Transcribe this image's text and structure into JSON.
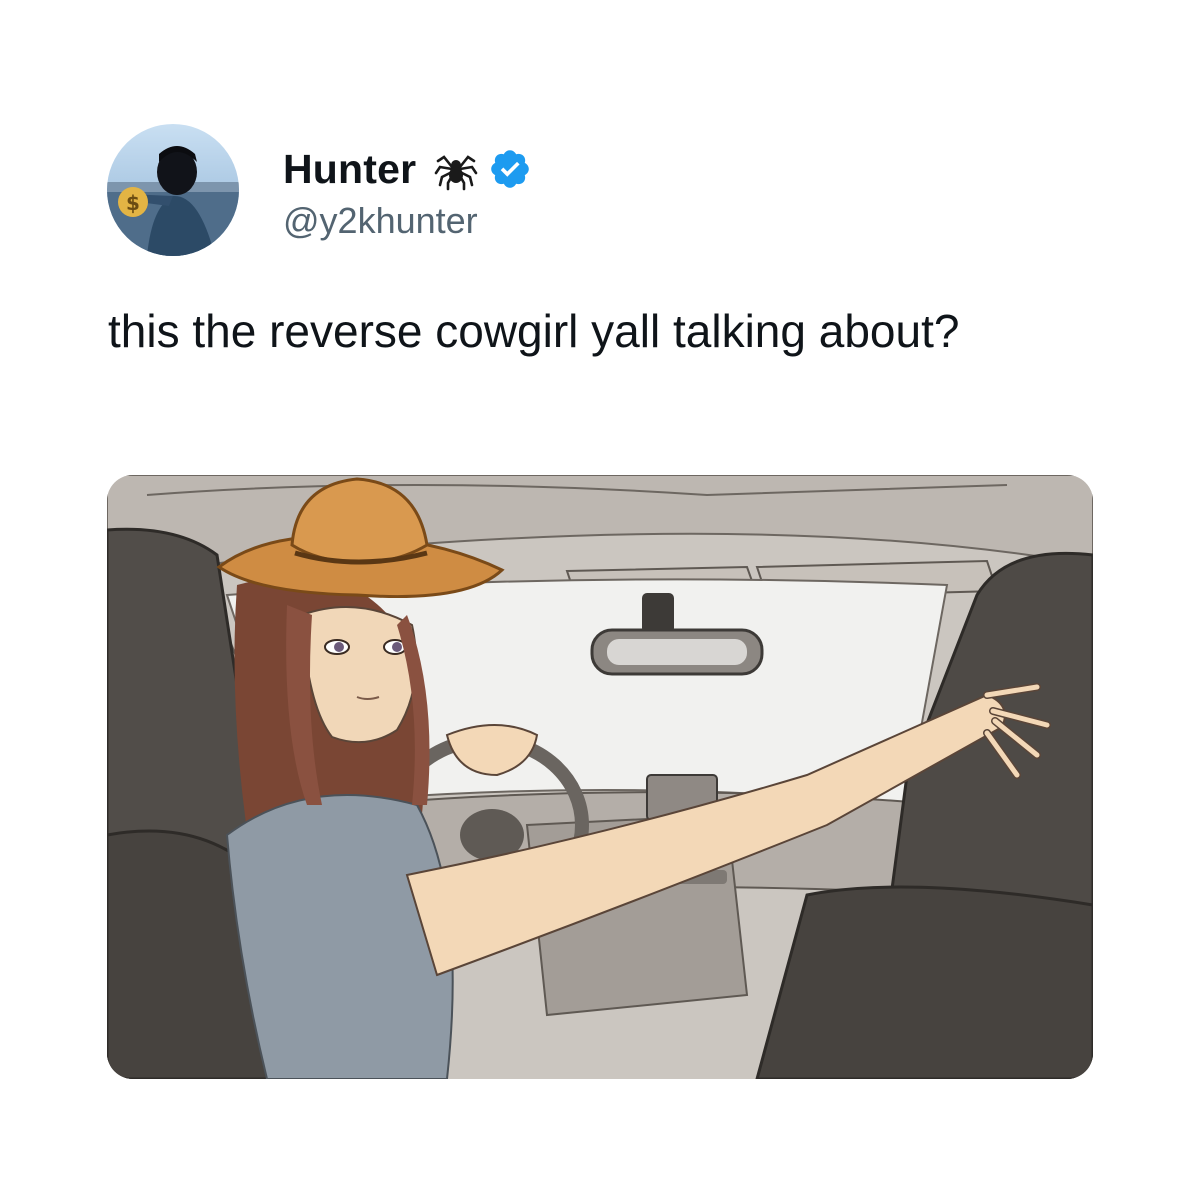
{
  "tweet": {
    "author": {
      "display_name": "Hunter",
      "name_emoji": "spider-icon",
      "verified": true,
      "handle": "@y2khunter",
      "avatar": "avatar-photo"
    },
    "text": "this the reverse cowgirl yall talking about?",
    "media": {
      "description_icon": "image",
      "scene": "illustration"
    }
  },
  "colors": {
    "verified_blue": "#1d9bf0",
    "handle_gray": "#536471",
    "text_black": "#0f1419"
  }
}
